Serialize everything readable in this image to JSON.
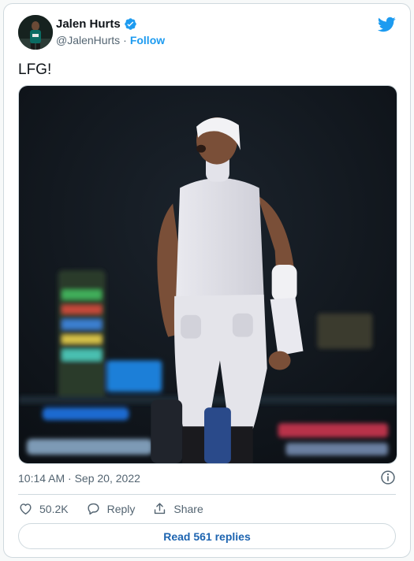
{
  "author": {
    "name": "Jalen Hurts",
    "handle": "@JalenHurts",
    "separator": "·",
    "follow_label": "Follow"
  },
  "icons": {
    "verified": "verified-badge-icon",
    "brand": "twitter-bird-icon",
    "info": "info-icon",
    "like": "heart-icon",
    "reply": "reply-bubble-icon",
    "share": "share-upload-icon"
  },
  "tweet": {
    "text": "LFG!",
    "timestamp": "10:14 AM · Sep 20, 2022"
  },
  "actions": {
    "like_count": "50.2K",
    "reply_label": "Reply",
    "share_label": "Share"
  },
  "footer": {
    "read_replies_label": "Read 561 replies"
  },
  "colors": {
    "brand_blue": "#1d9bf0",
    "link_blue": "#1d64b0",
    "muted_text": "#536471",
    "border": "#cfd9de"
  }
}
